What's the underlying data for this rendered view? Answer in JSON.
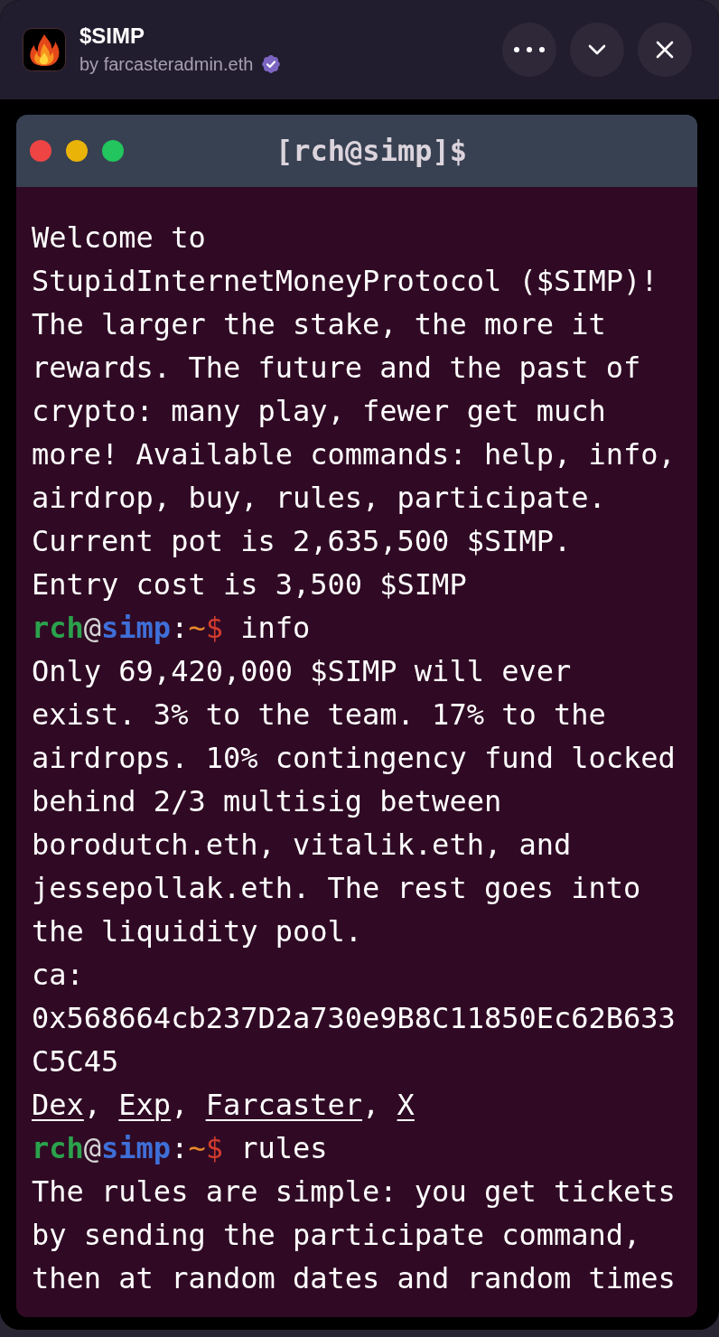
{
  "app_header": {
    "title": "$SIMP",
    "author": "by farcasteradmin.eth",
    "verified": true
  },
  "terminal": {
    "title": "[rch@simp]$",
    "lines": [
      {
        "kind": "output",
        "text": "Welcome to StupidInternetMoneyProtocol ($SIMP)! The larger the stake, the more it rewards. The future and the past of crypto: many play, fewer get much more! Available commands: help, info, airdrop, buy, rules, participate."
      },
      {
        "kind": "output",
        "text": "Current pot is 2,635,500 $SIMP."
      },
      {
        "kind": "output",
        "text": "Entry cost is 3,500 $SIMP"
      },
      {
        "kind": "prompt",
        "user": "rch",
        "at": "@",
        "host": "simp",
        "separator": ":",
        "path": "~",
        "symbol": "$",
        "command": "info"
      },
      {
        "kind": "output",
        "text": "Only 69,420,000 $SIMP will ever exist. 3% to the team. 17% to the airdrops. 10% contingency fund locked behind 2/3 multisig between borodutch.eth, vitalik.eth, and jessepollak.eth. The rest goes into the liquidity pool."
      },
      {
        "kind": "output",
        "text": "ca:"
      },
      {
        "kind": "output",
        "text": "0x568664cb237D2a730e9B8C11850Ec62B633C5C45"
      },
      {
        "kind": "links",
        "links": [
          {
            "label": "Dex",
            "after": ","
          },
          {
            "label": "Exp",
            "after": ","
          },
          {
            "label": "Farcaster",
            "after": ","
          },
          {
            "label": "X"
          }
        ]
      },
      {
        "kind": "prompt",
        "user": "rch",
        "at": "@",
        "host": "simp",
        "separator": ":",
        "path": "~",
        "symbol": "$",
        "command": "rules"
      },
      {
        "kind": "output",
        "text": "The rules are simple: you get tickets by sending the participate command, then at random dates and random times"
      }
    ]
  }
}
